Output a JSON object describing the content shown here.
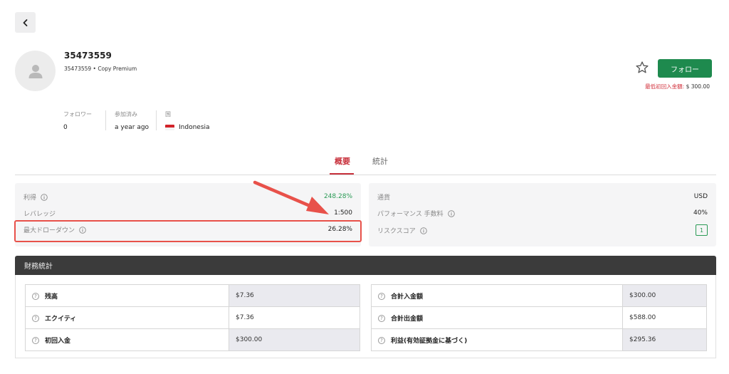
{
  "profile": {
    "name": "35473559",
    "subtitle": "35473559 • Copy Premium",
    "follow_label": "フォロー",
    "min_deposit_label": "最低初回入金額:",
    "min_deposit_value": " $ 300.00"
  },
  "stats": {
    "followers_label": "フォロワー",
    "followers_value": "0",
    "joined_label": "参加済み",
    "joined_value": "a year ago",
    "country_label": "国",
    "country_value": "Indonesia"
  },
  "tabs": [
    {
      "label": "概要",
      "active": true
    },
    {
      "label": "統計",
      "active": false
    }
  ],
  "overview_left": [
    {
      "label": "利得",
      "value": "248.28%"
    },
    {
      "label": "レバレッジ",
      "value": "1:500"
    },
    {
      "label": "最大ドローダウン",
      "value": "26.28%"
    }
  ],
  "overview_right": [
    {
      "label": "通貨",
      "value": "USD"
    },
    {
      "label": "パフォーマンス 手数料",
      "value": "40%"
    },
    {
      "label": "リスクスコア",
      "value": "1"
    }
  ],
  "financial": {
    "title": "財務統計",
    "left": [
      {
        "label": "残高",
        "value": "$7.36"
      },
      {
        "label": "エクイティ",
        "value": "$7.36"
      },
      {
        "label": "初回入金",
        "value": "$300.00"
      }
    ],
    "right": [
      {
        "label": "合計入金額",
        "value": "$300.00"
      },
      {
        "label": "合計出金額",
        "value": "$588.00"
      },
      {
        "label": "利益(有効証拠金に基づく)",
        "value": "$295.36"
      }
    ]
  },
  "colors": {
    "accent_red": "#c8323d",
    "follow_green": "#1e8a4e",
    "gain_green": "#2a9a55",
    "highlight": "#e8514a"
  },
  "icons": {
    "back": "chevron-left-icon",
    "avatar": "user-icon",
    "favorite": "star-icon",
    "info": "info-icon",
    "help": "question-icon"
  }
}
